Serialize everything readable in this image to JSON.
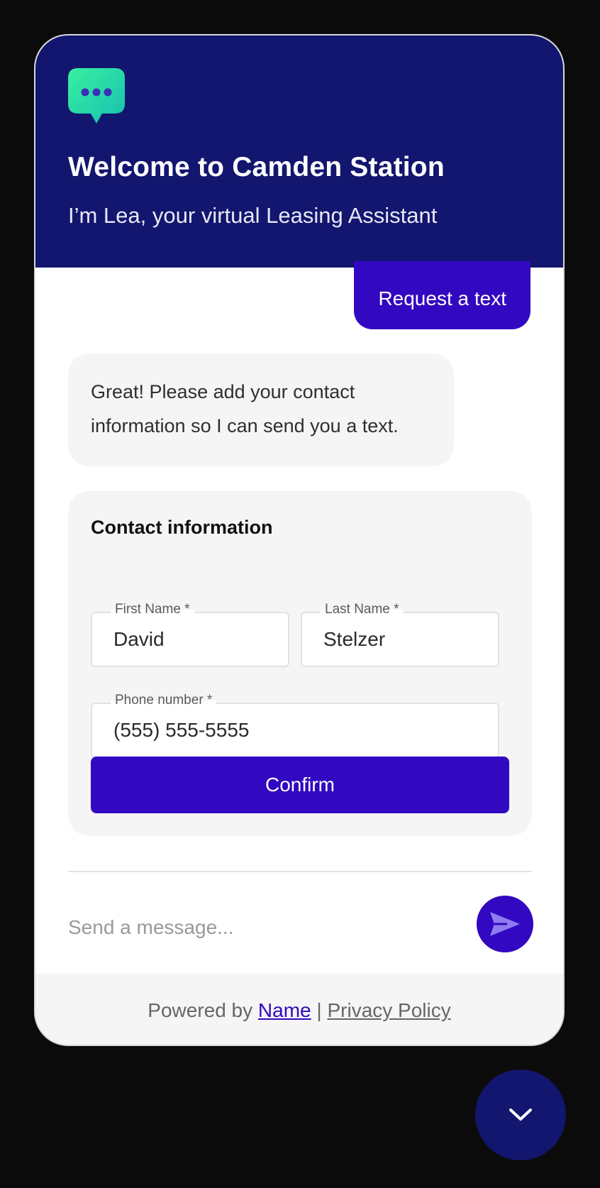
{
  "header": {
    "title": "Welcome to Camden Station",
    "subtitle": "I’m Lea, your virtual Leasing Assistant",
    "logo_icon": "chat-bubble-icon",
    "background_color": "#12166e"
  },
  "conversation": {
    "user_message": "Request a text",
    "bot_message": "Great! Please add your contact information so I can send you a text."
  },
  "contact_form": {
    "title": "Contact information",
    "first_name": {
      "label": "First Name *",
      "value": "David"
    },
    "last_name": {
      "label": "Last Name *",
      "value": "Stelzer"
    },
    "phone": {
      "label": "Phone number *",
      "value": "(555) 555-5555"
    },
    "confirm_label": "Confirm"
  },
  "composer": {
    "placeholder": "Send a message...",
    "send_icon": "send-icon"
  },
  "footer": {
    "powered_by": "Powered by",
    "name_link": "Name",
    "separator": "|",
    "privacy_link": "Privacy Policy"
  },
  "collapse_icon": "chevron-down-icon",
  "colors": {
    "accent": "#3208c0",
    "header": "#12166e",
    "logo_gradient_start": "#2fe3a1",
    "logo_gradient_end": "#1fc8a8"
  }
}
